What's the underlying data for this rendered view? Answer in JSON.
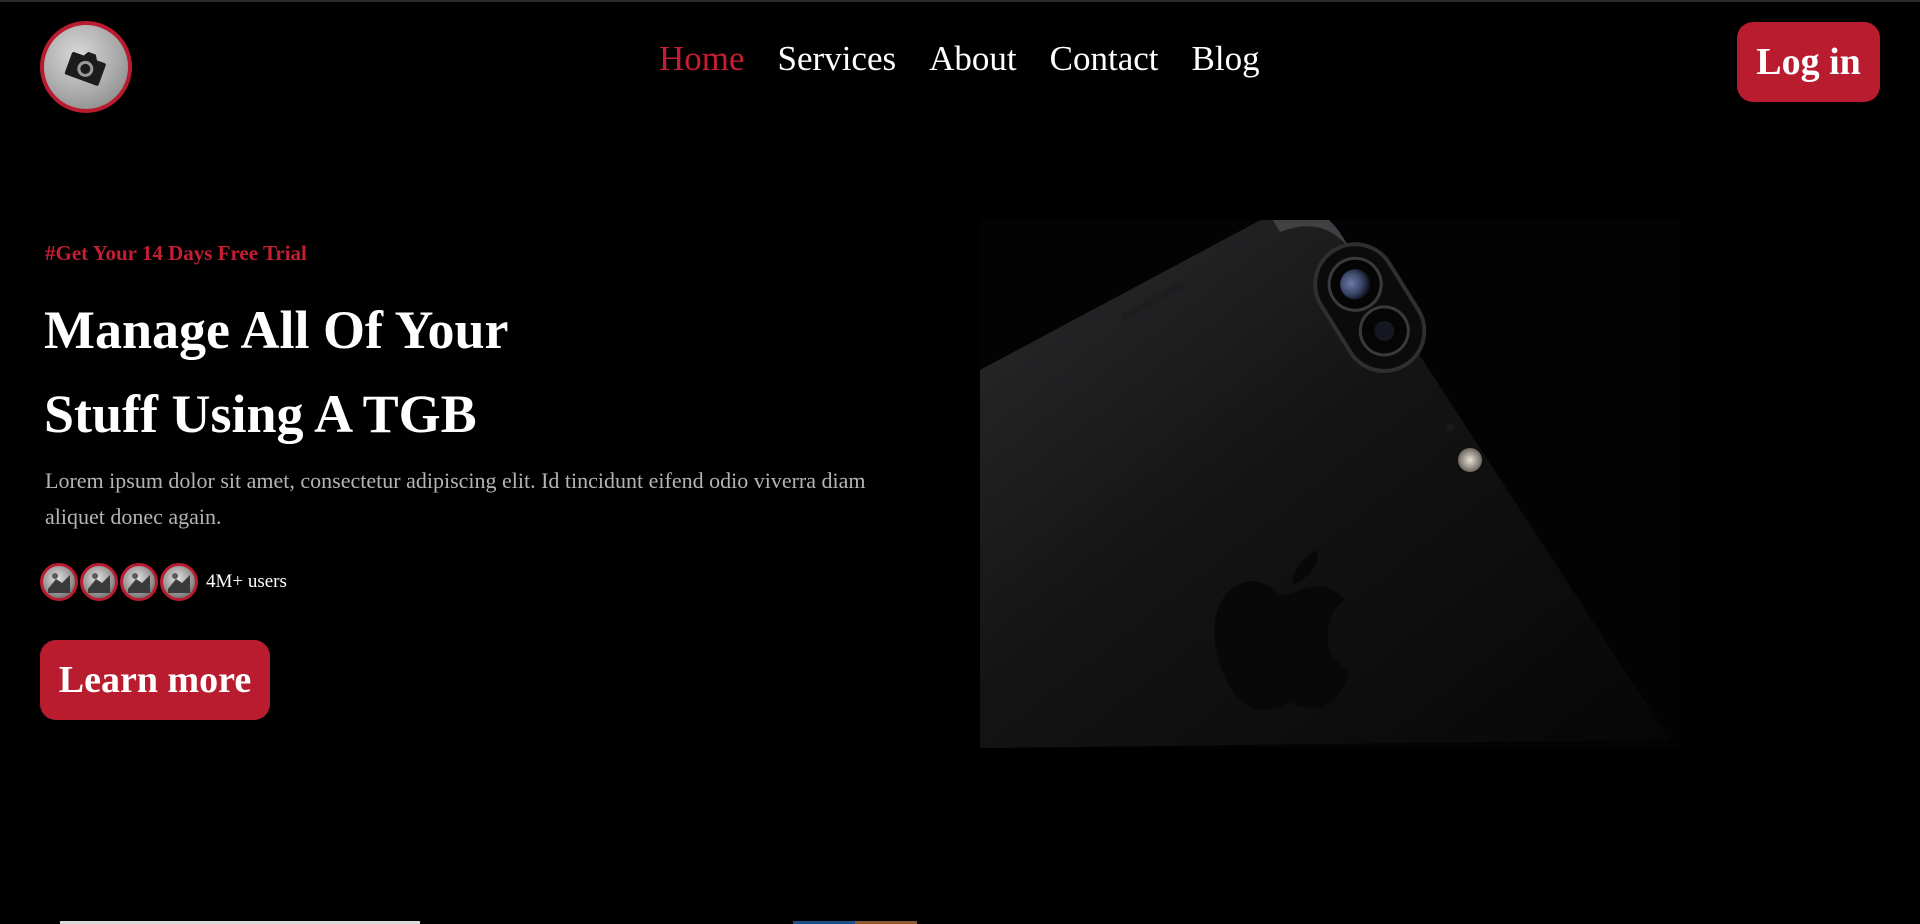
{
  "header": {
    "logo_icon": "camera-icon",
    "nav": [
      {
        "label": "Home",
        "active": true
      },
      {
        "label": "Services",
        "active": false
      },
      {
        "label": "About",
        "active": false
      },
      {
        "label": "Contact",
        "active": false
      },
      {
        "label": "Blog",
        "active": false
      }
    ],
    "login_label": "Log in"
  },
  "hero": {
    "tagline": "#Get Your 14 Days Free Trial",
    "headline_line1": "Manage All Of Your",
    "headline_line2": "Stuff Using A TGB",
    "description": "Lorem ipsum dolor sit amet, consectetur adipiscing elit. Id tincidunt eifend odio viverra diam aliquet donec again.",
    "users_count": "4M+ users",
    "avatar_count": 4,
    "cta_label": "Learn more",
    "image_icon": "smartphone-image"
  },
  "colors": {
    "accent": "#b81c2e",
    "active_link": "#c41e33",
    "background": "#000000",
    "text": "#ffffff",
    "muted_text": "#b4b4b4"
  }
}
